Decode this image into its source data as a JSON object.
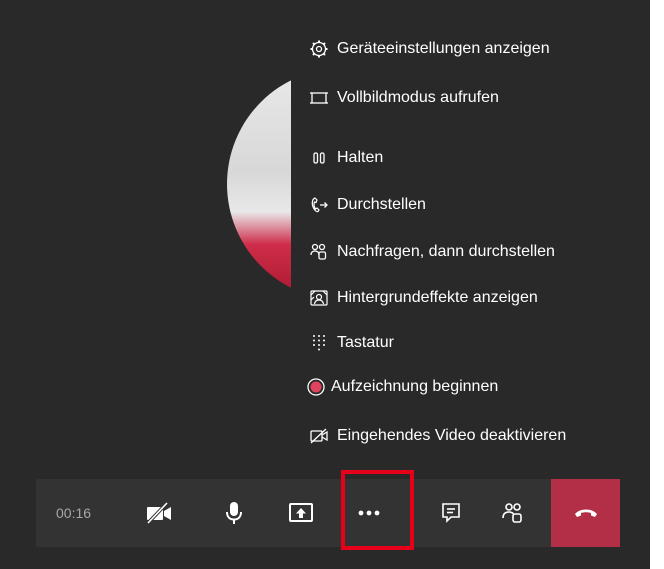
{
  "menu": {
    "items": [
      {
        "label": "Geräteeinstellungen anzeigen",
        "icon": "gear-icon"
      },
      {
        "label": "Vollbildmodus aufrufen",
        "icon": "fullscreen-icon"
      },
      {
        "label": "Halten",
        "icon": "hold-icon"
      },
      {
        "label": "Durchstellen",
        "icon": "transfer-icon"
      },
      {
        "label": "Nachfragen, dann durchstellen",
        "icon": "consult-transfer-icon"
      },
      {
        "label": "Hintergrundeffekte anzeigen",
        "icon": "background-effects-icon"
      },
      {
        "label": "Tastatur",
        "icon": "dialpad-icon"
      },
      {
        "label": "Aufzeichnung beginnen",
        "icon": "record-icon"
      },
      {
        "label": "Eingehendes Video deaktivieren",
        "icon": "video-off-icon"
      }
    ]
  },
  "toolbar": {
    "timer": "00:16",
    "buttons": [
      "camera-off-icon",
      "microphone-icon",
      "share-screen-icon",
      "more-actions-icon",
      "chat-icon",
      "participants-icon",
      "hang-up-icon"
    ]
  },
  "colors": {
    "background": "#292929",
    "toolbar": "#333333",
    "hangup": "#b22f47",
    "record": "#e0435f",
    "highlight": "#e6001a"
  }
}
